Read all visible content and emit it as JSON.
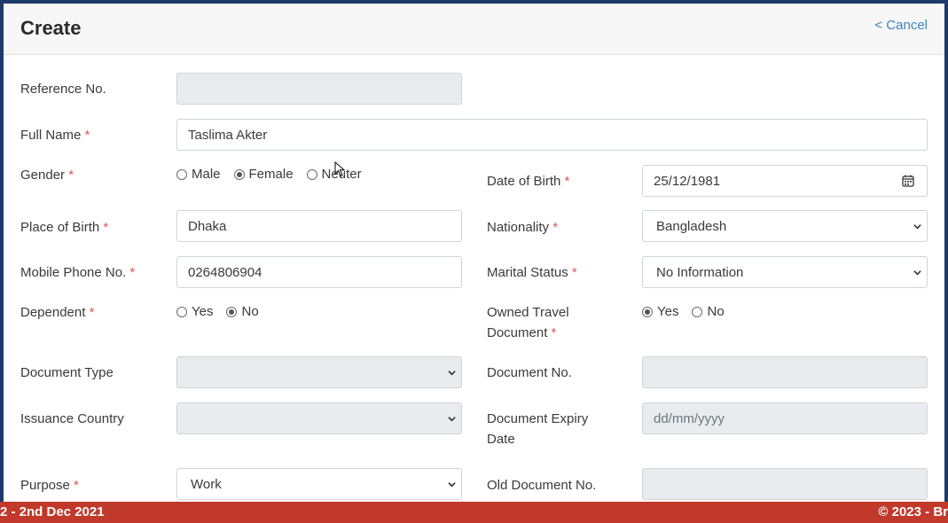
{
  "header": {
    "title": "Create",
    "cancel_label": "< Cancel"
  },
  "form": {
    "reference_no": {
      "label": "Reference No.",
      "value": ""
    },
    "full_name": {
      "label": "Full Name",
      "required": "*",
      "value": "Taslima Akter"
    },
    "gender": {
      "label": "Gender",
      "required": "*",
      "options": [
        "Male",
        "Female",
        "Neuter"
      ],
      "selected": "Female"
    },
    "date_of_birth": {
      "label": "Date of Birth",
      "required": "*",
      "value": "25/12/1981"
    },
    "place_of_birth": {
      "label": "Place of Birth",
      "required": "*",
      "value": "Dhaka"
    },
    "nationality": {
      "label": "Nationality",
      "required": "*",
      "value": "Bangladesh"
    },
    "mobile_phone": {
      "label": "Mobile Phone No.",
      "required": "*",
      "value": "0264806904"
    },
    "marital_status": {
      "label": "Marital Status",
      "required": "*",
      "value": "No Information"
    },
    "dependent": {
      "label": "Dependent",
      "required": "*",
      "options": [
        "Yes",
        "No"
      ],
      "selected": "No"
    },
    "owned_travel_document": {
      "label_line1": "Owned Travel",
      "label_line2": "Document",
      "required": "*",
      "options": [
        "Yes",
        "No"
      ],
      "selected": "Yes"
    },
    "document_type": {
      "label": "Document Type",
      "value": ""
    },
    "document_no": {
      "label": "Document No.",
      "value": ""
    },
    "issuance_country": {
      "label": "Issuance Country",
      "value": ""
    },
    "document_expiry_date": {
      "label_line1": "Document Expiry",
      "label_line2": "Date",
      "placeholder": "dd/mm/yyyy"
    },
    "purpose": {
      "label": "Purpose",
      "required": "*",
      "value": "Work"
    },
    "old_document_no": {
      "label": "Old Document No.",
      "value": ""
    }
  },
  "footer": {
    "left_text": "2 - 2nd Dec 2021",
    "right_text": "© 2023 - Br"
  },
  "colors": {
    "accent": "#3b82c4",
    "required": "#e05555",
    "footer_bg": "#c0392b",
    "disabled_bg": "#e9ecef"
  }
}
